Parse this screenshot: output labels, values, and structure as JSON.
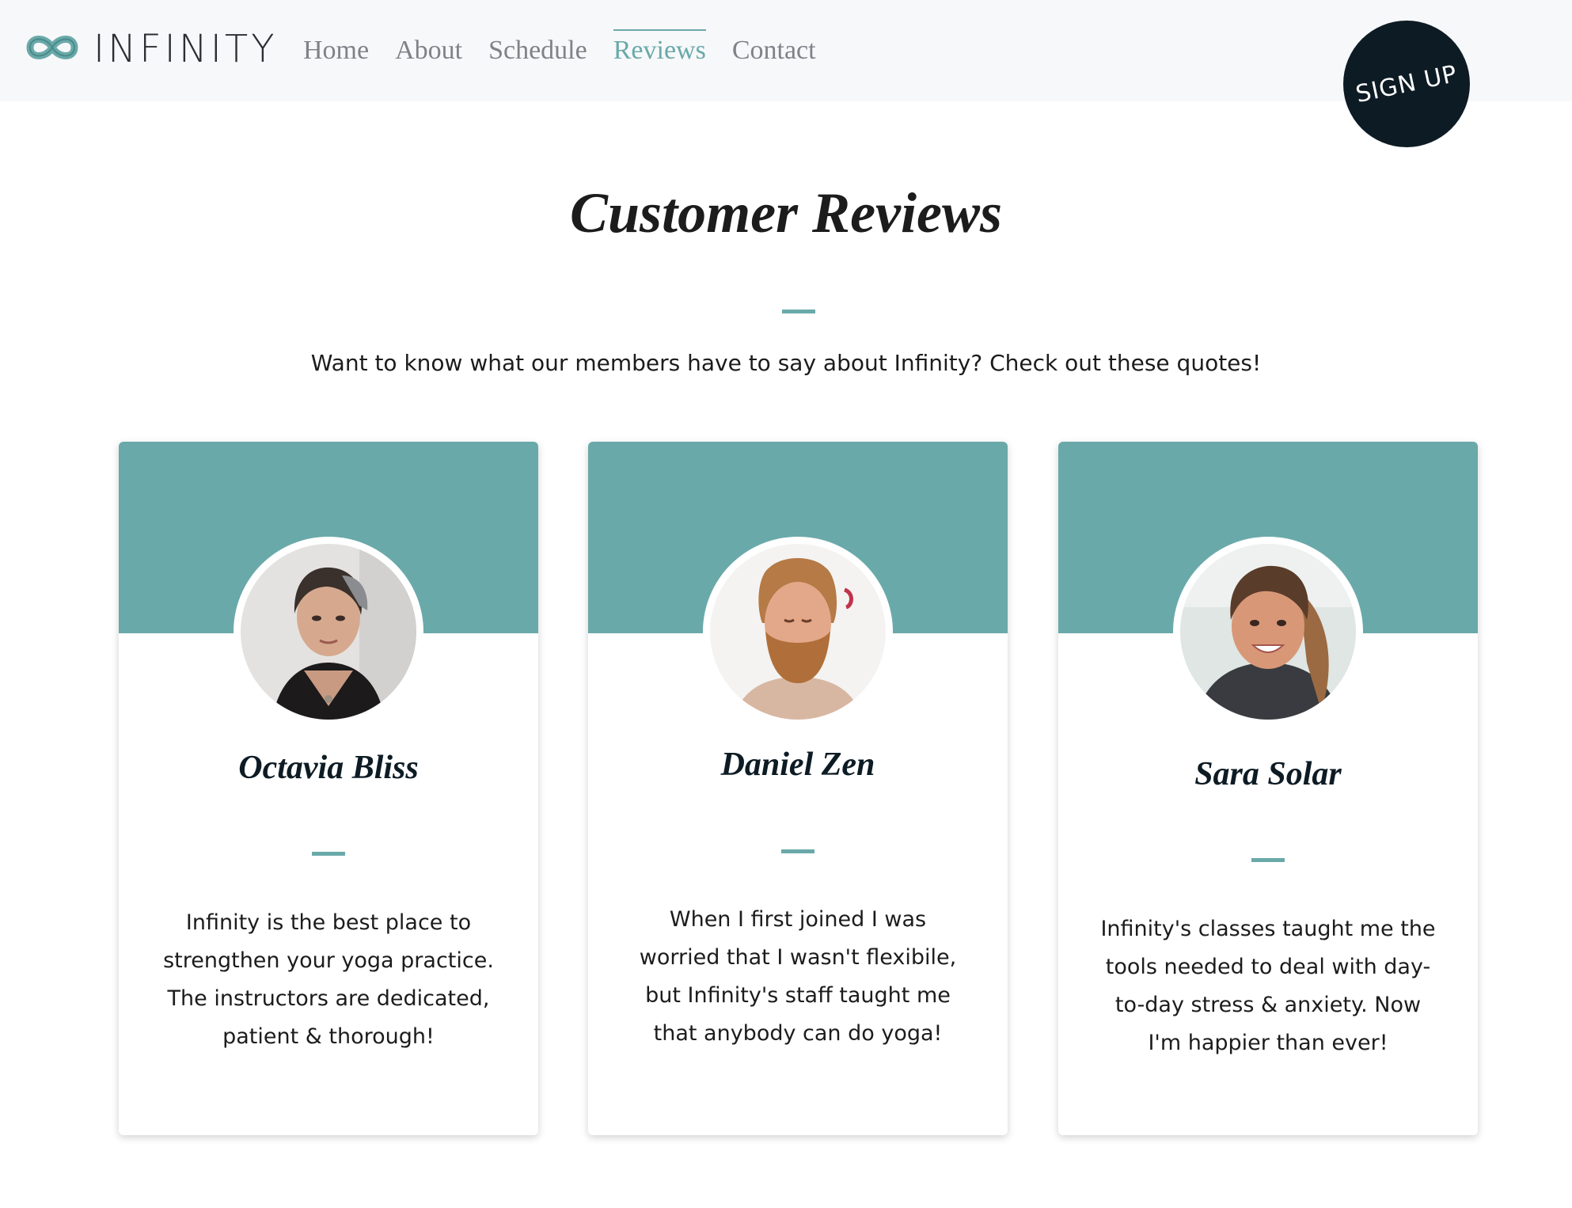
{
  "brand": {
    "name": "INFINITY",
    "logo_icon": "infinity-icon"
  },
  "nav": {
    "items": [
      {
        "label": "Home",
        "active": false
      },
      {
        "label": "About",
        "active": false
      },
      {
        "label": "Schedule",
        "active": false
      },
      {
        "label": "Reviews",
        "active": true
      },
      {
        "label": "Contact",
        "active": false
      }
    ]
  },
  "signup": {
    "label": "SIGN UP"
  },
  "page": {
    "title": "Customer Reviews",
    "subtitle": "Want to know what our members have to say about Infinity? Check out these quotes!"
  },
  "reviews": [
    {
      "name": "Octavia Bliss",
      "quote": "Infinity is the best place to strengthen your yoga practice. The instructors are dedicated, patient & thorough!"
    },
    {
      "name": "Daniel Zen",
      "quote": "When I first joined I was worried that I wasn't flexibile, but Infinity's staff taught me that anybody can do yoga!"
    },
    {
      "name": "Sara Solar",
      "quote": "Infinity's classes taught me the tools needed to deal with day-to-day stress & anxiety. Now I'm happier than ever!"
    }
  ],
  "colors": {
    "accent": "#6aa9a9",
    "dark": "#0d1b24",
    "header_bg": "#f7f8fa",
    "nav_text": "#7e8387"
  }
}
